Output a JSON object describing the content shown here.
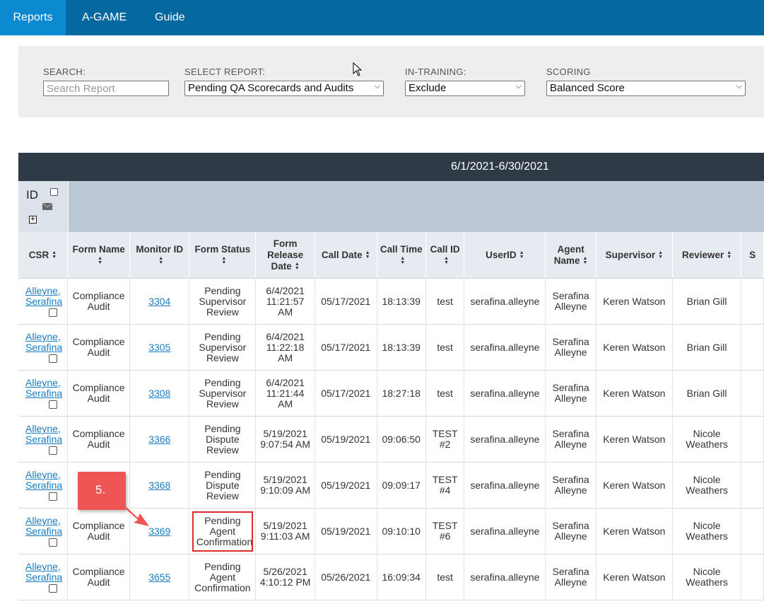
{
  "nav": {
    "tabs": [
      {
        "label": "Reports",
        "active": true
      },
      {
        "label": "A-GAME",
        "active": false
      },
      {
        "label": "Guide",
        "active": false
      }
    ]
  },
  "filters": {
    "search_label": "SEARCH:",
    "search_placeholder": "Search Report",
    "report_label": "SELECT REPORT:",
    "report_value": "Pending QA Scorecards and Audits",
    "training_label": "IN-TRAINING:",
    "training_value": "Exclude",
    "scoring_label": "SCORING",
    "scoring_value": "Balanced Score"
  },
  "report": {
    "date_range": "6/1/2021-6/30/2021",
    "id_label": "ID",
    "columns": [
      "CSR",
      "Form Name",
      "Monitor ID",
      "Form Status",
      "Form Release Date",
      "Call Date",
      "Call Time",
      "Call ID",
      "UserID",
      "Agent Name",
      "Supervisor",
      "Reviewer",
      "S"
    ],
    "rows": [
      {
        "csr": "Alleyne, Serafina",
        "form_name": "Compliance Audit",
        "monitor_id": "3304",
        "status": "Pending Supervisor Review",
        "release": "6/4/2021 11:21:57 AM",
        "call_date": "05/17/2021",
        "call_time": "18:13:39",
        "call_id": "test",
        "user_id": "serafina.alleyne",
        "agent": "Serafina Alleyne",
        "supervisor": "Keren Watson",
        "reviewer": "Brian Gill"
      },
      {
        "csr": "Alleyne, Serafina",
        "form_name": "Compliance Audit",
        "monitor_id": "3305",
        "status": "Pending Supervisor Review",
        "release": "6/4/2021 11:22:18 AM",
        "call_date": "05/17/2021",
        "call_time": "18:13:39",
        "call_id": "test",
        "user_id": "serafina.alleyne",
        "agent": "Serafina Alleyne",
        "supervisor": "Keren Watson",
        "reviewer": "Brian Gill"
      },
      {
        "csr": "Alleyne, Serafina",
        "form_name": "Compliance Audit",
        "monitor_id": "3308",
        "status": "Pending Supervisor Review",
        "release": "6/4/2021 11:21:44 AM",
        "call_date": "05/17/2021",
        "call_time": "18:27:18",
        "call_id": "test",
        "user_id": "serafina.alleyne",
        "agent": "Serafina Alleyne",
        "supervisor": "Keren Watson",
        "reviewer": "Brian Gill"
      },
      {
        "csr": "Alleyne, Serafina",
        "form_name": "Compliance Audit",
        "monitor_id": "3366",
        "status": "Pending Dispute Review",
        "release": "5/19/2021 9:07:54 AM",
        "call_date": "05/19/2021",
        "call_time": "09:06:50",
        "call_id": "TEST #2",
        "user_id": "serafina.alleyne",
        "agent": "Serafina Alleyne",
        "supervisor": "Keren Watson",
        "reviewer": "Nicole Weathers"
      },
      {
        "csr": "Alleyne, Serafina",
        "form_name": "C",
        "monitor_id": "3368",
        "status": "Pending Dispute Review",
        "release": "5/19/2021 9:10:09 AM",
        "call_date": "05/19/2021",
        "call_time": "09:09:17",
        "call_id": "TEST #4",
        "user_id": "serafina.alleyne",
        "agent": "Serafina Alleyne",
        "supervisor": "Keren Watson",
        "reviewer": "Nicole Weathers"
      },
      {
        "csr": "Alleyne, Serafina",
        "form_name": "Compliance Audit",
        "monitor_id": "3369",
        "status": "Pending Agent Confirmation",
        "release": "5/19/2021 9:11:03 AM",
        "call_date": "05/19/2021",
        "call_time": "09:10:10",
        "call_id": "TEST #6",
        "user_id": "serafina.alleyne",
        "agent": "Serafina Alleyne",
        "supervisor": "Keren Watson",
        "reviewer": "Nicole Weathers",
        "highlight": true
      },
      {
        "csr": "Alleyne, Serafina",
        "form_name": "Compliance Audit",
        "monitor_id": "3655",
        "status": "Pending Agent Confirmation",
        "release": "5/26/2021 4:10:12 PM",
        "call_date": "05/26/2021",
        "call_time": "16:09:34",
        "call_id": "test",
        "user_id": "serafina.alleyne",
        "agent": "Serafina Alleyne",
        "supervisor": "Keren Watson",
        "reviewer": "Nicole Weathers"
      }
    ]
  },
  "annotation": {
    "step_label": "5.",
    "color": "#f05555"
  },
  "colors": {
    "nav": "#05699f",
    "nav_active": "#0b8ad1",
    "banner": "#2e3b47",
    "link": "#1a7cc1",
    "highlight": "#e02b2b"
  }
}
